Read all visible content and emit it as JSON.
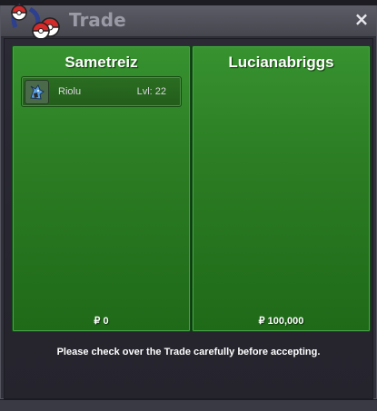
{
  "window": {
    "title": "Trade",
    "close_label": "×"
  },
  "left_trader": {
    "name": "Sametreiz",
    "items": [
      {
        "icon": "riolu-sprite-icon",
        "name": "Riolu",
        "level": "Lvl: 22"
      }
    ],
    "money": "₽ 0"
  },
  "right_trader": {
    "name": "Lucianabriggs",
    "items": [],
    "money": "₽ 100,000"
  },
  "message": "Please check over the Trade carefully before accepting.",
  "colors": {
    "panel_green": "#2c7d24",
    "window_bg": "#31313b",
    "title_text": "#9a9aa6"
  }
}
